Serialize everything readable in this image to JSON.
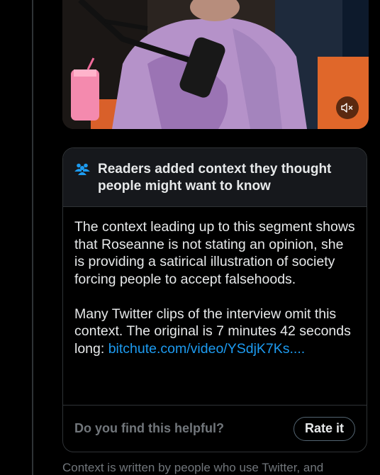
{
  "note": {
    "title": "Readers added context they thought people might want to know",
    "paragraph1": "The context leading up to this segment shows that Roseanne is not stating an opinion, she is providing a satirical illustration of society forcing people to accept falsehoods.",
    "paragraph2_text": "Many Twitter clips of the interview omit this context. The original is 7 minutes 42 seconds long: ",
    "link_text": "bitchute.com/video/YSdjK7Ks....",
    "helpful_question": "Do you find this helpful?",
    "rate_label": "Rate it"
  },
  "video": {
    "mute_icon": "speaker-muted-icon"
  },
  "disclaimer": "Context is written by people who use Twitter, and",
  "colors": {
    "background": "#000000",
    "text": "#e7e9ea",
    "muted": "#71767b",
    "link": "#1d9bf0",
    "border": "#2f3336",
    "header_bg": "#16181c"
  }
}
